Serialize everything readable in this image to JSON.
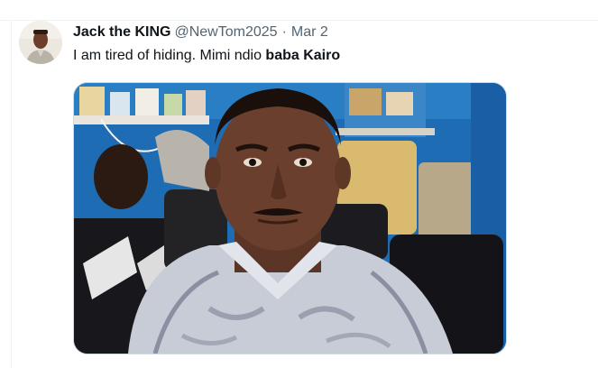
{
  "tweet": {
    "display_name": "Jack the KING",
    "handle": "@NewTom2025",
    "separator": "·",
    "date": "Mar 2",
    "text_plain": "I am tired of hiding. Mimi ndio ",
    "text_bold": "baba Kairo",
    "avatar_icon": "user-avatar",
    "media": {
      "kind": "photo",
      "description_icon": "photo-of-man-in-barbershop"
    }
  },
  "colors": {
    "text_primary": "#0f1419",
    "text_secondary": "#536471",
    "border": "#eff3f4",
    "media_border": "#cfd9de",
    "wall_blue": "#1e6fb7"
  }
}
